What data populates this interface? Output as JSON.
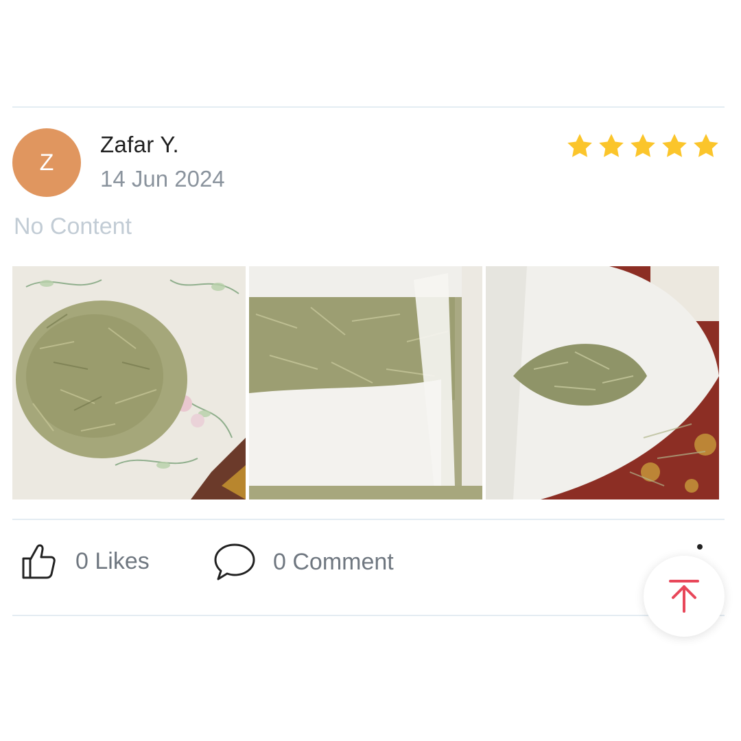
{
  "review": {
    "avatar_initial": "Z",
    "author": "Zafar Y.",
    "date": "14 Jun 2024",
    "rating": 5,
    "content": "No Content"
  },
  "photos": [
    {
      "alt": "rosemary-leaves-on-plate-icon"
    },
    {
      "alt": "rosemary-in-pouch-icon"
    },
    {
      "alt": "open-pouch-rosemary-icon"
    }
  ],
  "actions": {
    "likes_label": "0 Likes",
    "comments_label": "0 Comment"
  },
  "colors": {
    "avatar_bg": "#e0965f",
    "star": "#fbc52b",
    "scroll_top_arrow": "#e8475a"
  }
}
